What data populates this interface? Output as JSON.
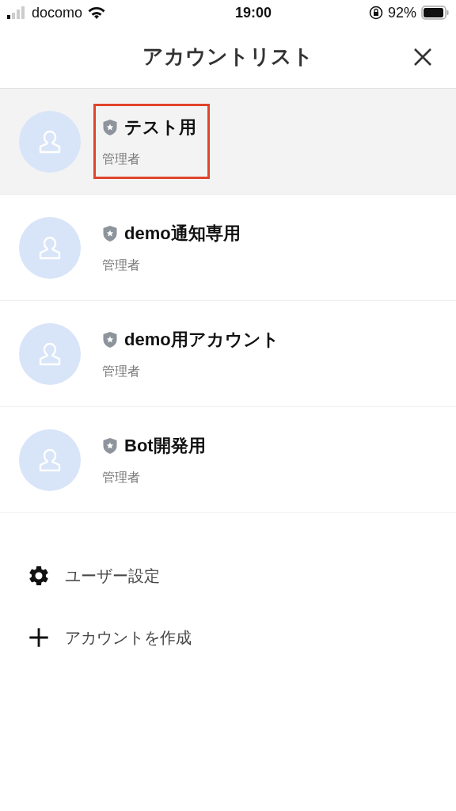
{
  "status_bar": {
    "carrier": "docomo",
    "time": "19:00",
    "battery": "92%"
  },
  "header": {
    "title": "アカウントリスト"
  },
  "accounts": [
    {
      "name": "テスト用",
      "role": "管理者",
      "selected": true,
      "annotated": true
    },
    {
      "name": "demo通知専用",
      "role": "管理者",
      "selected": false,
      "annotated": false
    },
    {
      "name": "demo用アカウント",
      "role": "管理者",
      "selected": false,
      "annotated": false
    },
    {
      "name": "Bot開発用",
      "role": "管理者",
      "selected": false,
      "annotated": false
    }
  ],
  "menu": [
    {
      "kind": "settings",
      "label": "ユーザー設定"
    },
    {
      "kind": "create",
      "label": "アカウントを作成"
    }
  ]
}
